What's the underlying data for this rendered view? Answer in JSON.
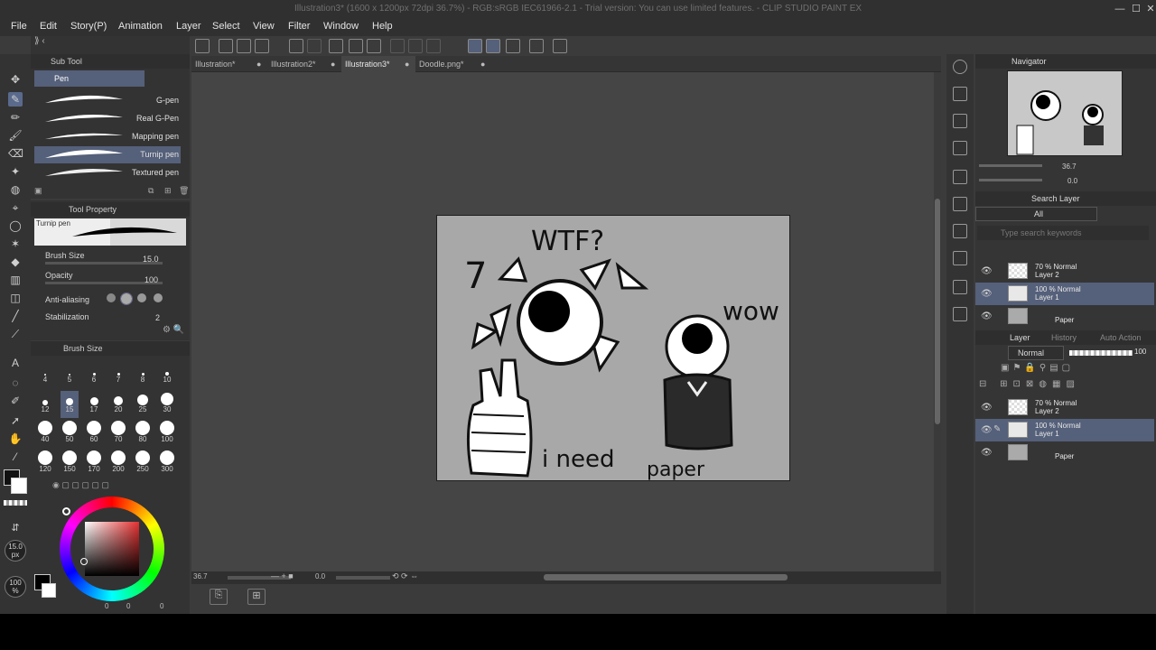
{
  "window": {
    "title": "Illustration3* (1600 x 1200px 72dpi 36.7%)  - RGB:sRGB IEC61966-2.1 - Trial version: You can use limited features. - CLIP STUDIO PAINT EX",
    "minimize": "—",
    "maximize": "☐",
    "close": "✕"
  },
  "menu": [
    "File",
    "Edit",
    "Story(P)",
    "Animation",
    "Layer",
    "Select",
    "View",
    "Filter",
    "Window",
    "Help"
  ],
  "tabs": [
    {
      "label": "Illustration*",
      "close": "●"
    },
    {
      "label": "Illustration2*",
      "close": "●"
    },
    {
      "label": "Illustration3*",
      "close": "●"
    },
    {
      "label": "Doodle.png*",
      "close": "●"
    }
  ],
  "subtool": {
    "header": "Sub Tool",
    "group": "Pen",
    "brushes": [
      "G-pen",
      "Real G-Pen",
      "Mapping pen",
      "Turnip pen",
      "Textured pen"
    ],
    "selected": "Turnip pen"
  },
  "toolprop": {
    "header": "Tool Property",
    "preview_label": "Turnip pen",
    "brush_size_label": "Brush Size",
    "brush_size": "15.0",
    "opacity_label": "Opacity",
    "opacity": "100",
    "antialias_label": "Anti-aliasing",
    "stabilization_label": "Stabilization",
    "stabilization": "2"
  },
  "brushsize": {
    "header": "Brush Size",
    "sizes": [
      "4",
      "5",
      "6",
      "7",
      "8",
      "10",
      "12",
      "15",
      "17",
      "20",
      "25",
      "30",
      "40",
      "50",
      "60",
      "70",
      "80",
      "100",
      "120",
      "150",
      "170",
      "200",
      "250",
      "300"
    ],
    "selected": "15"
  },
  "colorwheel": {
    "size_label": "15.0",
    "size_unit": "px",
    "opacity_label": "100",
    "opacity_unit": "%",
    "values": [
      "0",
      "0",
      "0"
    ]
  },
  "navigator": {
    "header": "Navigator",
    "zoom": "36.7",
    "angle": "0.0"
  },
  "searchlayer": {
    "header": "Search Layer",
    "filter": "All",
    "placeholder": "Type search keywords"
  },
  "layers_top": [
    {
      "mode": "70 % Normal",
      "name": "Layer 2"
    },
    {
      "mode": "100 % Normal",
      "name": "Layer 1"
    },
    {
      "mode": "",
      "name": "Paper"
    }
  ],
  "layerpanel": {
    "header": "Layer",
    "tab2": "History",
    "tab3": "Auto Action",
    "blend": "Normal",
    "opacity": "100"
  },
  "layers": [
    {
      "mode": "70 % Normal",
      "name": "Layer 2"
    },
    {
      "mode": "100 % Normal",
      "name": "Layer 1"
    },
    {
      "mode": "",
      "name": "Paper"
    }
  ],
  "status": {
    "zoom": "36.7",
    "angle": "0.0"
  },
  "drawing_text": {
    "top": "WTF?",
    "left": "7",
    "right": "wow",
    "bottom1": "i need",
    "bottom2": "paper"
  },
  "colors": {
    "accent": "#55607a",
    "bg": "#3b3b3b",
    "canvas": "#a8a8a8"
  }
}
